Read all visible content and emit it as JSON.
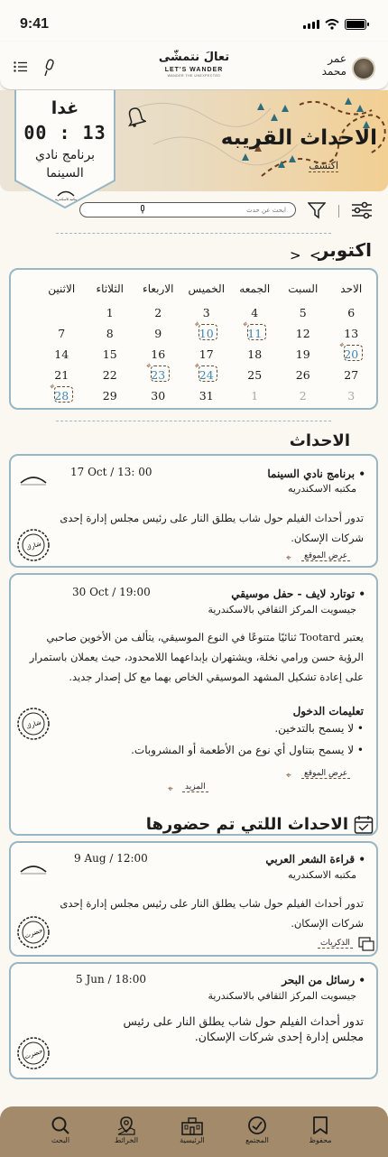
{
  "status_bar": {
    "time": "9:41"
  },
  "header": {
    "user_first": "عمر",
    "user_last": "محمد",
    "logo_ar": "تعالَ نتمشّى",
    "logo_en": "LET'S WANDER",
    "logo_sub": "WANDER THE UNEXPECTED"
  },
  "hero": {
    "title": "الاحداث القريبه",
    "explore": "اكتشف"
  },
  "countdown": {
    "day": "غدا",
    "time": "00 : 13",
    "event": "برنامج نادي السينما",
    "logo_caption": "مكتبة الاسكندرية"
  },
  "search": {
    "placeholder": "ابحث عن حدث"
  },
  "calendar": {
    "month": "اكتوبر",
    "weekdays": [
      "الاحد",
      "السبت",
      "الجمعه",
      "الخميس",
      "الاربعاء",
      "الثلاثاء",
      "الاثنين"
    ],
    "rows": [
      [
        "6",
        "5",
        "4",
        "3",
        "2",
        "1",
        ""
      ],
      [
        "13",
        "12",
        "11",
        "10",
        "9",
        "8",
        "7"
      ],
      [
        "20",
        "19",
        "18",
        "17",
        "16",
        "15",
        "14"
      ],
      [
        "27",
        "26",
        "25",
        "24",
        "23",
        "22",
        "21"
      ],
      [
        "3",
        "2",
        "1",
        "31",
        "30",
        "29",
        "28"
      ]
    ],
    "event_days": [
      "10",
      "11",
      "20",
      "23",
      "24",
      "28"
    ],
    "accent_color": "#3f86b4"
  },
  "events_section": {
    "title": "الاحداث",
    "cards": [
      {
        "title": "برنامج نادي السينما",
        "venue": "مكتبه الاسكندريه",
        "date": "17 Oct / 13: 00",
        "desc": "تدور أحداث الفيلم حول شاب يطلق النار على رئيس مجلس إدارة إحدى شركات الإسكان.",
        "stamp": "شارك",
        "map_link": "عرض الموقع"
      },
      {
        "title": "توتارد لايف - حفل موسيقي",
        "venue": "جيسويت المركز الثقافي بالاسكندرية",
        "date": "30 Oct  /  19:00",
        "desc": "يعتبر Tootard ثنائيًا متنوعًا في النوع الموسيقي، يتألف من الأخوين صاحبي الرؤية حسن ورامي نخلة، ويشتهران بإبداعهما اللامحدود، حيث يعملان باستمرار على إعادة تشكيل المشهد الموسيقي الخاص بهما مع كل إصدار جديد.",
        "rules_title": "تعليمات الدخول",
        "rules": [
          "لا يسمح بالتدخين.",
          "لا يسمح بتناول أي نوع من الأطعمة أو المشروبات."
        ],
        "stamp": "شارك",
        "map_link": "عرض الموقع",
        "more": "المزيد"
      }
    ]
  },
  "attended_section": {
    "title": "الاحداث اللتي تم حضورها",
    "cards": [
      {
        "title": "قراءة الشعر العربي",
        "venue": "مكتبه الاسكندريه",
        "date": "9 Aug / 12:00",
        "desc": "تدور أحداث الفيلم حول شاب يطلق النار على رئيس مجلس إدارة إحدى شركات الإسكان.",
        "stamp": "حضرت",
        "memories": "الذكريات"
      },
      {
        "title": "رسائل من البحر",
        "venue": "جيسويت المركز الثقافي بالاسكندرية",
        "date": "5  Jun / 18:00",
        "desc": "تدور أحداث الفيلم حول شاب يطلق النار على رئيس مجلس إدارة إحدى شركات الإسكان.",
        "stamp": "حضرت"
      }
    ]
  },
  "bottom_nav": [
    {
      "label": "البحث",
      "icon": "search-icon"
    },
    {
      "label": "الخرائط",
      "icon": "map-pin-icon"
    },
    {
      "label": "الرئيسية",
      "icon": "home-icon"
    },
    {
      "label": "المجتمع",
      "icon": "compass-icon"
    },
    {
      "label": "محفوظ",
      "icon": "bookmark-icon"
    }
  ],
  "colors": {
    "nav_bg": "#a28a6a",
    "card_border": "#98b6c4",
    "accent_brown": "#6b4b2f"
  }
}
